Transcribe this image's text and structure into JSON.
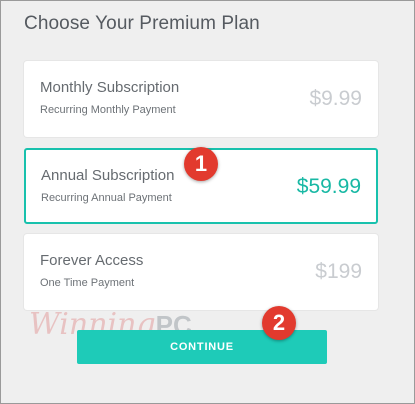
{
  "title": "Choose Your Premium Plan",
  "plans": [
    {
      "name": "Monthly Subscription",
      "subtitle": "Recurring Monthly Payment",
      "price": "$9.99",
      "selected": false
    },
    {
      "name": "Annual Subscription",
      "subtitle": "Recurring Annual Payment",
      "price": "$59.99",
      "selected": true
    },
    {
      "name": "Forever Access",
      "subtitle": "One Time Payment",
      "price": "$199",
      "selected": false
    }
  ],
  "continue_label": "CONTINUE",
  "watermark": {
    "script": "Winning",
    "bold": "PC"
  },
  "annotations": [
    "1",
    "2"
  ],
  "colors": {
    "accent": "#1ecbb8",
    "badge": "#e23a2e",
    "price_muted": "#c9ccd0"
  }
}
